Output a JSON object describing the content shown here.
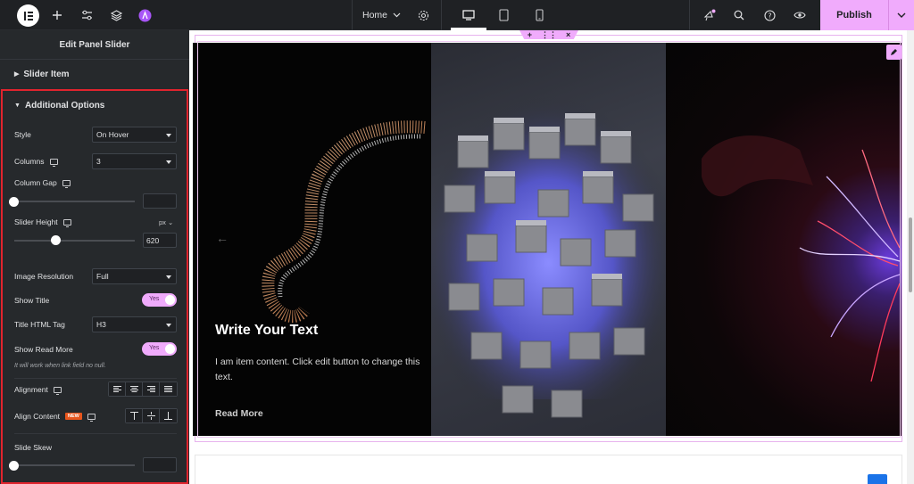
{
  "topbar": {
    "page_name": "Home",
    "publish_label": "Publish",
    "icons": [
      "elementor-logo-icon",
      "plus-icon",
      "sliders-icon",
      "layers-icon",
      "site-icon",
      "gear-icon",
      "desktop-icon",
      "tablet-icon",
      "mobile-icon",
      "notifications-icon",
      "search-icon",
      "help-icon",
      "eye-icon",
      "chevron-down-icon"
    ],
    "accent_color": "#f0abfc"
  },
  "panel": {
    "title": "Edit Panel Slider",
    "sections": {
      "slider_item": "Slider Item",
      "additional_options": "Additional Options"
    },
    "controls": {
      "style_label": "Style",
      "style_value": "On Hover",
      "columns_label": "Columns",
      "columns_value": "3",
      "column_gap_label": "Column Gap",
      "column_gap_value": "",
      "slider_height_label": "Slider Height",
      "slider_height_unit": "px",
      "slider_height_value": "620",
      "image_resolution_label": "Image Resolution",
      "image_resolution_value": "Full",
      "show_title_label": "Show Title",
      "show_title_toggle": "Yes",
      "title_tag_label": "Title HTML Tag",
      "title_tag_value": "H3",
      "show_read_more_label": "Show Read More",
      "show_read_more_toggle": "Yes",
      "read_more_hint": "It will work when link field no null.",
      "alignment_label": "Alignment",
      "align_content_label": "Align Content",
      "new_badge": "NEW",
      "slide_skew_label": "Slide Skew",
      "slide_skew_value": ""
    },
    "highlight_color": "#e0242e"
  },
  "canvas": {
    "slide_title": "Write Your Text",
    "slide_text": "I am item content. Click edit button to change this text.",
    "slide_link": "Read More"
  }
}
